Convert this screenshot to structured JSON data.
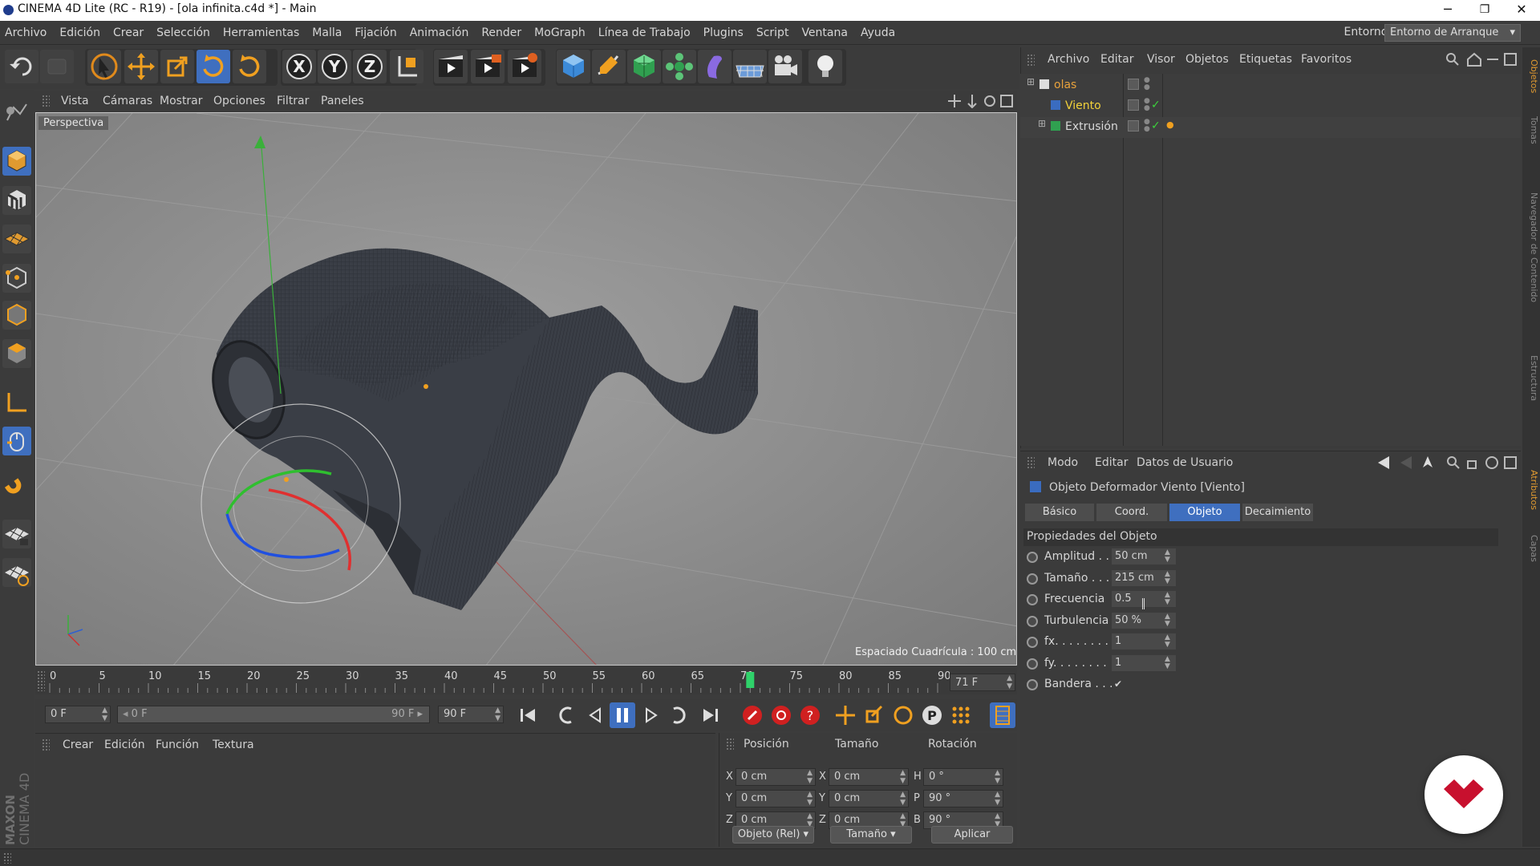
{
  "window": {
    "title": "CINEMA 4D Lite (RC - R19) - [ola infinita.c4d *] - Main",
    "minimize": "─",
    "restore": "❐",
    "close": "✕"
  },
  "menu": [
    "Archivo",
    "Edición",
    "Crear",
    "Selección",
    "Herramientas",
    "Malla",
    "Fijación",
    "Animación",
    "Render",
    "MoGraph",
    "Línea de Trabajo",
    "Plugins",
    "Script",
    "Ventana",
    "Ayuda"
  ],
  "environment": {
    "label": "Entorno:",
    "value": "Entorno de Arranque"
  },
  "toolbar_icons": [
    "undo-icon",
    "redo-icon",
    "select-arrow-icon",
    "move-icon",
    "scale-icon",
    "rotate-icon",
    "recent-tool-icon",
    "x-axis-icon",
    "y-axis-icon",
    "z-axis-icon",
    "coordinate-system-icon",
    "render-view-icon",
    "render-picture-viewer-icon",
    "edit-render-settings-icon",
    "cube-icon",
    "pen-icon",
    "subdivision-icon",
    "array-icon",
    "deformer-icon",
    "floor-icon",
    "camera-icon",
    "light-icon"
  ],
  "toolbar_axes": [
    "X",
    "Y",
    "Z"
  ],
  "viewport": {
    "menu": [
      "Vista",
      "Cámaras",
      "Mostrar",
      "Opciones",
      "Filtrar",
      "Paneles"
    ],
    "label": "Perspectiva",
    "grid_note": "Espaciado Cuadrícula : 100 cm"
  },
  "timeline": {
    "ticks": [
      "0",
      "5",
      "10",
      "15",
      "20",
      "25",
      "30",
      "35",
      "40",
      "45",
      "50",
      "55",
      "60",
      "65",
      "70",
      "75",
      "80",
      "85",
      "90"
    ],
    "current_frame_value": 71,
    "frame_max": 90,
    "current_frame": "71 F"
  },
  "transport": {
    "start": "0 F",
    "range_start": "0 F",
    "range_end": "90 F",
    "end": "90 F"
  },
  "materials": {
    "menu": [
      "Crear",
      "Edición",
      "Función",
      "Textura"
    ]
  },
  "coords": {
    "headers": [
      "Posición",
      "Tamaño",
      "Rotación"
    ],
    "rows": [
      {
        "axis": "X",
        "pos": "0 cm",
        "size_axis": "X",
        "size": "0 cm",
        "rot_axis": "H",
        "rot": "0 °"
      },
      {
        "axis": "Y",
        "pos": "0 cm",
        "size_axis": "Y",
        "size": "0 cm",
        "rot_axis": "P",
        "rot": "90 °"
      },
      {
        "axis": "Z",
        "pos": "0 cm",
        "size_axis": "Z",
        "size": "0 cm",
        "rot_axis": "B",
        "rot": "90 °"
      }
    ],
    "mode": "Objeto (Rel)",
    "size_mode": "Tamaño",
    "apply": "Aplicar"
  },
  "logo": {
    "brand": "MAXON",
    "product": "CINEMA 4D"
  },
  "objects": {
    "menu": [
      "Archivo",
      "Editar",
      "Visor",
      "Objetos",
      "Etiquetas",
      "Favoritos"
    ],
    "items": [
      {
        "name": "olas",
        "color": "#e8a23c",
        "indent": 0
      },
      {
        "name": "Viento",
        "color": "#f2d23a",
        "indent": 1
      },
      {
        "name": "Extrusión",
        "color": "#d8d8d8",
        "indent": 1
      }
    ]
  },
  "attributes": {
    "menu": [
      "Modo",
      "Editar",
      "Datos de Usuario"
    ],
    "object_title": "Objeto Deformador Viento [Viento]",
    "tabs": [
      "Básico",
      "Coord.",
      "Objeto",
      "Decaimiento"
    ],
    "active_tab": "Objeto",
    "section": "Propiedades del Objeto",
    "props": [
      {
        "label": "Amplitud . .",
        "value": "50 cm"
      },
      {
        "label": "Tamaño . . .",
        "value": "215 cm"
      },
      {
        "label": "Frecuencia",
        "value": "0.5"
      },
      {
        "label": "Turbulencia",
        "value": "50 %"
      },
      {
        "label": "fx. . . . . . . .",
        "value": "1"
      },
      {
        "label": "fy. . . . . . . .",
        "value": "1"
      },
      {
        "label": "Bandera . . .",
        "value": "✔"
      }
    ]
  },
  "side_tabs": [
    "Objetos",
    "Tomas",
    "Navegador de Contenido",
    "Estructura",
    "Atributos",
    "Capas"
  ],
  "colors": {
    "accent": "#3f6fbf",
    "panel": "#3b3b3b",
    "viewport": "#8d8d8d",
    "badge_heart": "#c8102e"
  }
}
